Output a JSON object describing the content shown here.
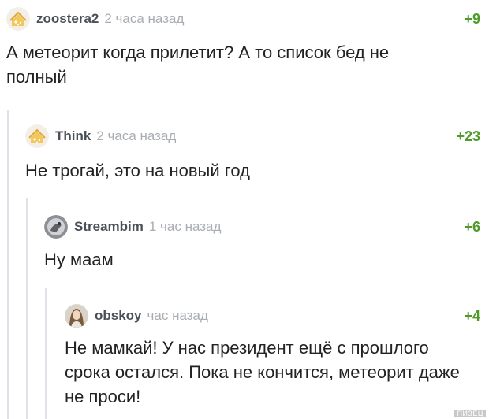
{
  "comments": [
    {
      "username": "zoostera2",
      "time": "2 часа назад",
      "rating": "+9",
      "text": "А метеорит когда прилетит? А то список бед не полный",
      "avatar": "default-avatar-icon"
    },
    {
      "username": "Think",
      "time": "2 часа назад",
      "rating": "+23",
      "text": "Не трогай, это на новый год",
      "avatar": "default-avatar-icon"
    },
    {
      "username": "Streambim",
      "time": "1 час назад",
      "rating": "+6",
      "text": "Ну маам",
      "avatar": "user-photo-avatar"
    },
    {
      "username": "obskoy",
      "time": "час назад",
      "rating": "+4",
      "text": "Не мамкай! У нас президент ещё с прошлого срока остался. Пока не кончится, метеорит даже не проси!",
      "avatar": "user-photo-avatar"
    }
  ],
  "watermark": "ПИЗЕЦ",
  "colors": {
    "rating": "#4f9b2a",
    "username": "#4a5058",
    "time": "#a9adb2",
    "thread_line": "#dfe3e8"
  }
}
